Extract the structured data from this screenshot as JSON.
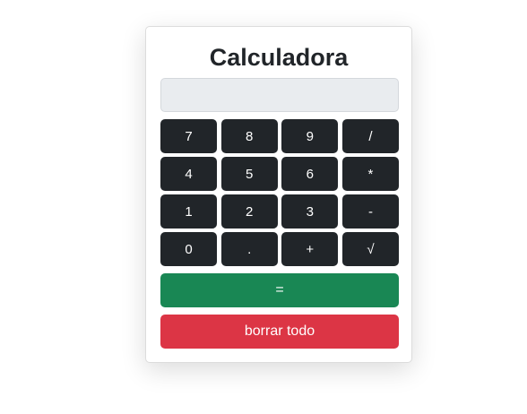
{
  "calculator": {
    "title": "Calculadora",
    "display_value": "",
    "keys": [
      "7",
      "8",
      "9",
      "/",
      "4",
      "5",
      "6",
      "*",
      "1",
      "2",
      "3",
      "-",
      "0",
      ".",
      "+",
      "√"
    ],
    "equals_label": "=",
    "clear_label": "borrar todo"
  },
  "colors": {
    "key_background": "#212529",
    "equals_background": "#198754",
    "clear_background": "#dc3545",
    "display_background": "#e9ecef"
  }
}
